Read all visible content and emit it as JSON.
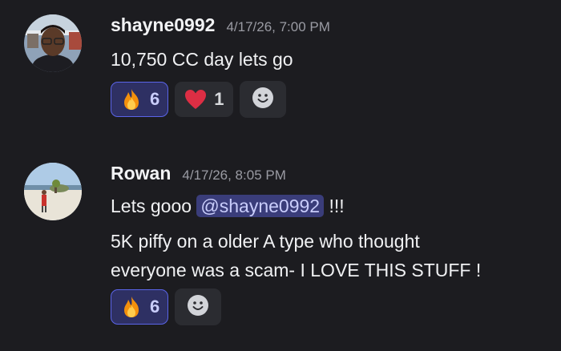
{
  "messages": [
    {
      "username": "shayne0992",
      "timestamp": "4/17/26, 7:00 PM",
      "lines": [
        "10,750 CC day lets go"
      ],
      "reactions": [
        {
          "emoji": "fire-emoji",
          "count": "6",
          "active": true
        },
        {
          "emoji": "red-heart-emoji",
          "count": "1",
          "active": false
        }
      ]
    },
    {
      "username": "Rowan",
      "timestamp": "4/17/26, 8:05 PM",
      "line1_prefix": "Lets gooo ",
      "mention": "@shayne0992",
      "line1_suffix": " !!!",
      "line2": "5K piffy on a older A type who thought",
      "line3": "everyone was a scam- I LOVE THIS STUFF !",
      "reactions": [
        {
          "emoji": "fire-emoji",
          "count": "6",
          "active": true
        }
      ]
    }
  ],
  "colors": {
    "background": "#1c1c20",
    "mention_bg": "#3a3d7a",
    "reaction_active_border": "#5a64e8"
  }
}
